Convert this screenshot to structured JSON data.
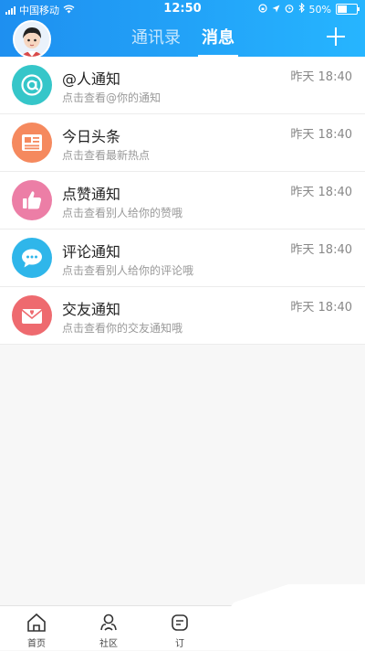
{
  "status_bar": {
    "carrier": "中国移动",
    "time": "12:50",
    "battery": "50%",
    "battery_level": 0.5
  },
  "header": {
    "tabs": [
      {
        "label": "通讯录"
      },
      {
        "label": "消息"
      }
    ]
  },
  "messages": [
    {
      "title": "@人通知",
      "desc": "点击查看@你的通知",
      "time": "昨天 18:40",
      "icon": "at-icon",
      "color": "#35c6c9"
    },
    {
      "title": "今日头条",
      "desc": "点击查看最新热点",
      "time": "昨天 18:40",
      "icon": "newspaper-icon",
      "color": "#f5895e"
    },
    {
      "title": "点赞通知",
      "desc": "点击查看别人给你的赞哦",
      "time": "昨天 18:40",
      "icon": "thumbs-up-icon",
      "color": "#ec7ea6"
    },
    {
      "title": "评论通知",
      "desc": "点击查看别人给你的评论哦",
      "time": "昨天 18:40",
      "icon": "chat-bubble-icon",
      "color": "#2fb6ea"
    },
    {
      "title": "交友通知",
      "desc": "点击查看你的交友通知哦",
      "time": "昨天 18:40",
      "icon": "envelope-heart-icon",
      "color": "#ee6a6f"
    }
  ],
  "tabbar": {
    "items": [
      {
        "label": "首页",
        "icon": "home-icon"
      },
      {
        "label": "社区",
        "icon": "community-icon"
      },
      {
        "label": "订",
        "icon": "partial-icon"
      }
    ]
  }
}
